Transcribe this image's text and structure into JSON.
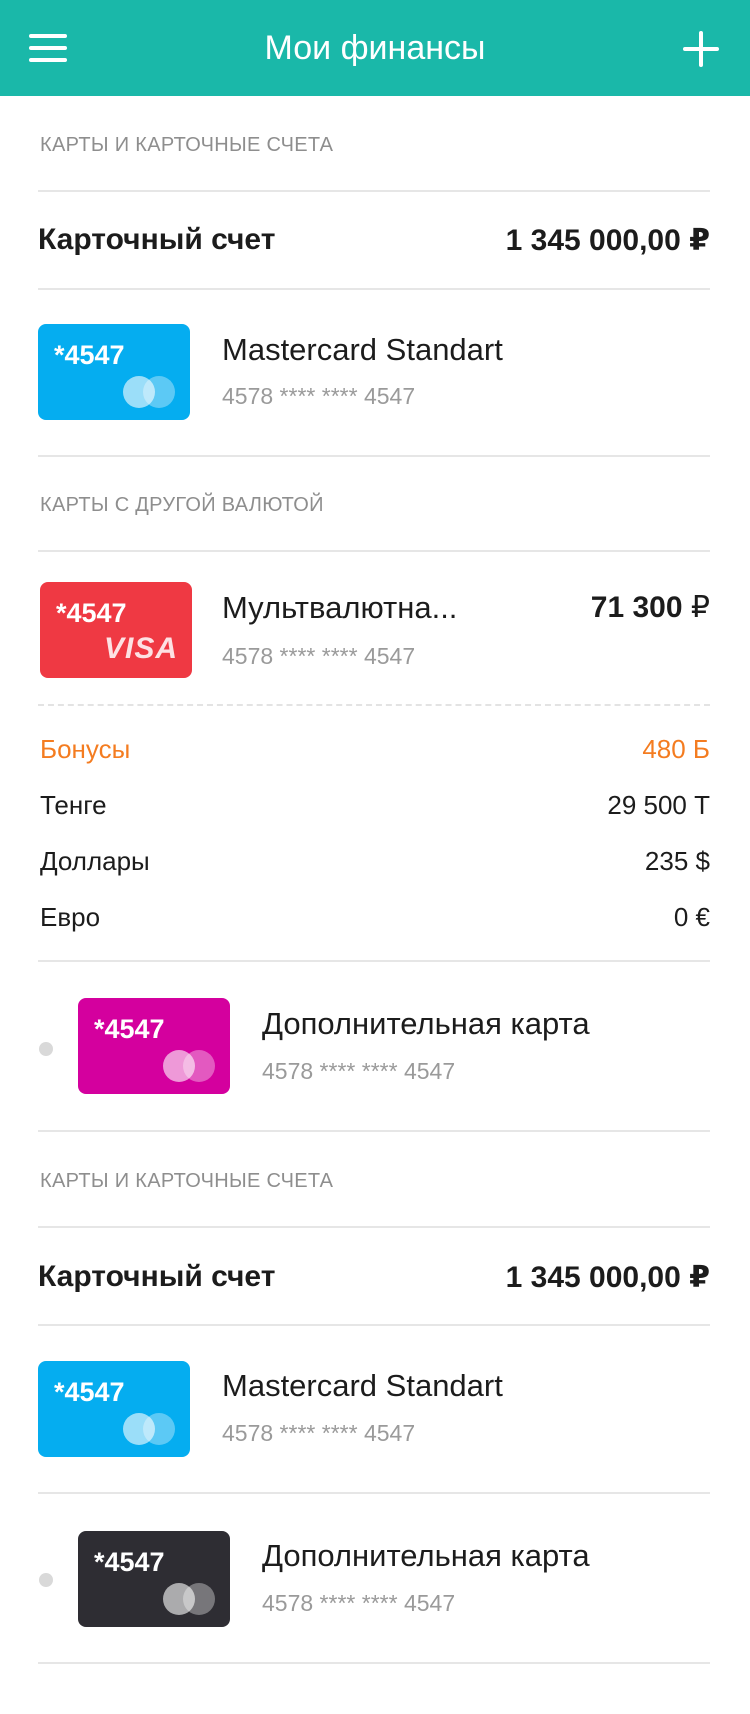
{
  "header": {
    "title": "Мои финансы",
    "colors": {
      "background": "#1ab8a9"
    }
  },
  "sections": [
    {
      "title": "КАРТЫ И КАРТОЧНЫЕ СЧЕТА",
      "account": {
        "label": "Карточный счет",
        "amount": "1 345 000,00 ₽"
      },
      "cards": [
        {
          "short": "*4547",
          "name": "Mastercard Standart",
          "masked": "4578 **** **** 4547",
          "color": "#05adf0",
          "brand": "mastercard-logo-icon"
        }
      ]
    },
    {
      "title": "КАРТЫ С ДРУГОЙ ВАЛЮТОЙ",
      "cards": [
        {
          "short": "*4547",
          "name": "Мультвалютна...",
          "masked": "4578 **** **** 4547",
          "balance_value": "71 300",
          "balance_currency": "₽",
          "color": "#ef3943",
          "brand": "visa-logo-icon",
          "brand_text": "VISA"
        },
        {
          "short": "*4547",
          "name": "Дополнительная карта",
          "masked": "4578 **** **** 4547",
          "color": "#d4009e",
          "brand": "mastercard-logo-icon"
        }
      ],
      "balances": [
        {
          "label": "Бонусы",
          "value": "480 Б",
          "color": "#f47c20"
        },
        {
          "label": "Тенге",
          "value": "29 500 Т"
        },
        {
          "label": "Доллары",
          "value": "235 $"
        },
        {
          "label": "Евро",
          "value": "0 €"
        }
      ]
    },
    {
      "title": "КАРТЫ И КАРТОЧНЫЕ СЧЕТА",
      "account": {
        "label": "Карточный счет",
        "amount": "1 345 000,00 ₽"
      },
      "cards": [
        {
          "short": "*4547",
          "name": "Mastercard Standart",
          "masked": "4578 **** **** 4547",
          "color": "#05adf0",
          "brand": "mastercard-logo-icon"
        },
        {
          "short": "*4547",
          "name": "Дополнительная карта",
          "masked": "4578 **** **** 4547",
          "color": "#2e2d33",
          "brand": "mastercard-logo-icon"
        }
      ]
    }
  ]
}
